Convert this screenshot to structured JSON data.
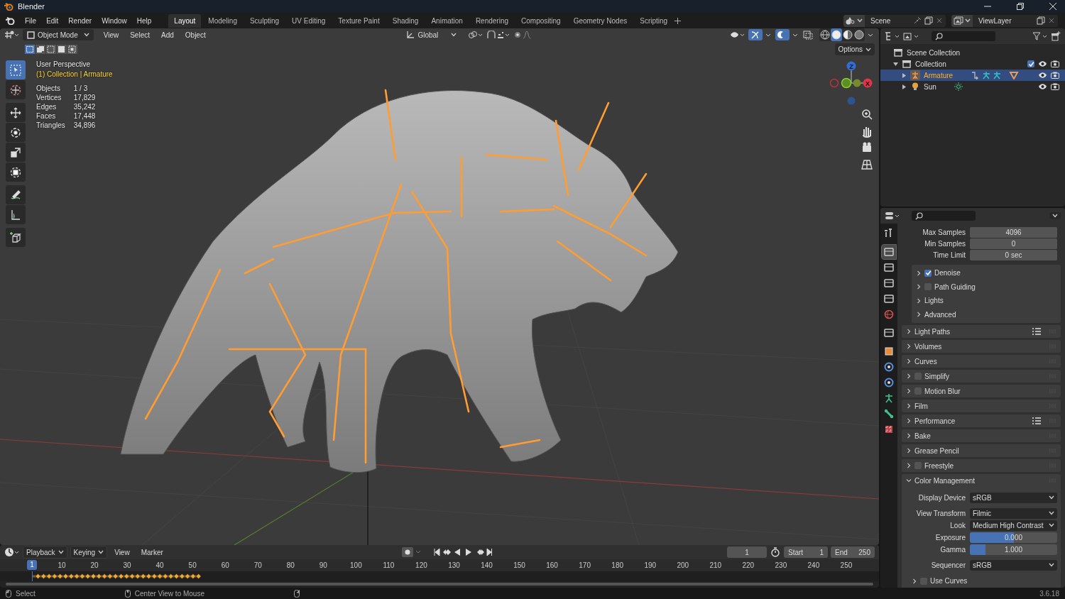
{
  "window": {
    "title": "Blender"
  },
  "menu": [
    "File",
    "Edit",
    "Render",
    "Window",
    "Help"
  ],
  "workspaces": [
    {
      "label": "Layout",
      "selected": true
    },
    {
      "label": "Modeling",
      "selected": false
    },
    {
      "label": "Sculpting",
      "selected": false
    },
    {
      "label": "UV Editing",
      "selected": false
    },
    {
      "label": "Texture Paint",
      "selected": false
    },
    {
      "label": "Shading",
      "selected": false
    },
    {
      "label": "Animation",
      "selected": false
    },
    {
      "label": "Rendering",
      "selected": false
    },
    {
      "label": "Compositing",
      "selected": false
    },
    {
      "label": "Geometry Nodes",
      "selected": false
    },
    {
      "label": "Scripting",
      "selected": false
    }
  ],
  "scene": "Scene",
  "view_layer": "ViewLayer",
  "viewport": {
    "mode": "Object Mode",
    "menus": [
      "View",
      "Select",
      "Add",
      "Object"
    ],
    "orientation": "Global",
    "options": "Options",
    "view_name": "User Perspective",
    "context": "(1) Collection | Armature",
    "stats": [
      {
        "label": "Objects",
        "value": "1 / 3"
      },
      {
        "label": "Vertices",
        "value": "17,829"
      },
      {
        "label": "Edges",
        "value": "35,242"
      },
      {
        "label": "Faces",
        "value": "17,448"
      },
      {
        "label": "Triangles",
        "value": "34,896"
      }
    ],
    "shading": [
      {
        "kind": "wireframe",
        "selected": false
      },
      {
        "kind": "solid",
        "selected": true
      },
      {
        "kind": "material",
        "selected": false
      },
      {
        "kind": "rendered",
        "selected": false
      }
    ],
    "axes": [
      {
        "label": "Z",
        "color": "#2f6fd5"
      },
      {
        "label": "X",
        "color": "#e0344a"
      }
    ]
  },
  "tools": [
    {
      "kind": "select",
      "selected": true
    },
    {
      "kind": "cursor",
      "selected": false
    },
    {
      "kind": "move",
      "selected": false
    },
    {
      "kind": "rotate",
      "selected": false
    },
    {
      "kind": "scale",
      "selected": false
    },
    {
      "kind": "transform",
      "selected": false
    },
    {
      "kind": "annotate",
      "selected": false
    },
    {
      "kind": "measure",
      "selected": false
    },
    {
      "kind": "add-cube",
      "selected": false
    }
  ],
  "outliner": [
    {
      "label": "Scene Collection",
      "kind": "scene",
      "selected": false,
      "children": [
        {
          "label": "Collection",
          "kind": "collection",
          "selected": false,
          "expanded": true,
          "checked": true,
          "children": [
            {
              "label": "Armature",
              "kind": "armature",
              "selected": true,
              "expanded": false
            },
            {
              "label": "Sun",
              "kind": "light",
              "selected": false,
              "expanded": false
            }
          ]
        }
      ]
    }
  ],
  "properties": {
    "tabs": [
      {
        "kind": "tool",
        "selected": false
      },
      {
        "kind": "render",
        "selected": true
      },
      {
        "kind": "output",
        "selected": false
      },
      {
        "kind": "view-layer",
        "selected": false
      },
      {
        "kind": "scene",
        "selected": false
      },
      {
        "kind": "world",
        "selected": false
      },
      {
        "kind": "collection",
        "selected": false
      },
      {
        "kind": "object",
        "selected": false
      },
      {
        "kind": "physics",
        "selected": false
      },
      {
        "kind": "constraints",
        "selected": false
      },
      {
        "kind": "data",
        "selected": false
      },
      {
        "kind": "bone",
        "selected": false
      },
      {
        "kind": "texture",
        "selected": false
      }
    ],
    "fields": [
      {
        "label": "Max Samples",
        "value": "4096"
      },
      {
        "label": "Min Samples",
        "value": "0"
      },
      {
        "label": "Time Limit",
        "value": "0 sec"
      }
    ],
    "subpanels": [
      {
        "label": "Denoise",
        "kind": "checkbox",
        "checked": true,
        "expanded": false
      },
      {
        "label": "Path Guiding",
        "kind": "checkbox",
        "checked": false,
        "expanded": false
      },
      {
        "label": "Lights",
        "kind": "plain",
        "expanded": false
      },
      {
        "label": "Advanced",
        "kind": "plain",
        "expanded": false
      }
    ],
    "panels": [
      {
        "label": "Light Paths",
        "kind": "presets",
        "expanded": false
      },
      {
        "label": "Volumes",
        "kind": "plain",
        "expanded": false
      },
      {
        "label": "Curves",
        "kind": "plain",
        "expanded": false
      },
      {
        "label": "Simplify",
        "kind": "checkbox",
        "checked": false,
        "expanded": false
      },
      {
        "label": "Motion Blur",
        "kind": "checkbox",
        "checked": false,
        "expanded": false
      },
      {
        "label": "Film",
        "kind": "plain",
        "expanded": false
      },
      {
        "label": "Performance",
        "kind": "presets",
        "expanded": false
      },
      {
        "label": "Bake",
        "kind": "plain",
        "expanded": false
      },
      {
        "label": "Grease Pencil",
        "kind": "plain",
        "expanded": false
      },
      {
        "label": "Freestyle",
        "kind": "checkbox",
        "checked": false,
        "expanded": false
      },
      {
        "label": "Color Management",
        "kind": "plain",
        "expanded": true
      }
    ],
    "color_management": [
      {
        "label": "Display Device",
        "kind": "dropdown",
        "value": "sRGB"
      },
      {
        "label": "View Transform",
        "kind": "dropdown",
        "value": "Filmic"
      },
      {
        "label": "Look",
        "kind": "dropdown",
        "value": "Medium High Contrast"
      },
      {
        "label": "Exposure",
        "kind": "slider",
        "value": "0.000",
        "level": 0.5
      },
      {
        "label": "Gamma",
        "kind": "slider",
        "value": "1.000",
        "level": 0.18
      },
      {
        "label": "Sequencer",
        "kind": "dropdown",
        "value": "sRGB"
      }
    ],
    "use_curves": {
      "label": "Use Curves",
      "checked": false,
      "expanded": false
    }
  },
  "timeline": {
    "menus": [
      {
        "label": "Playback",
        "kind": "dropdown"
      },
      {
        "label": "Keying",
        "kind": "dropdown"
      },
      {
        "label": "View",
        "kind": "menu"
      },
      {
        "label": "Marker",
        "kind": "menu"
      }
    ],
    "current_frame": "1",
    "start_label": "Start",
    "start": "1",
    "end_label": "End",
    "end": "250",
    "playhead": "1",
    "ruler": [
      "10",
      "20",
      "30",
      "40",
      "50",
      "60",
      "70",
      "80",
      "90",
      "100",
      "110",
      "120",
      "130",
      "140",
      "150",
      "160",
      "170",
      "180",
      "190",
      "200",
      "210",
      "220",
      "230",
      "240",
      "250"
    ]
  },
  "status_bar": {
    "hints": [
      "Select",
      "Center View to Mouse"
    ],
    "version": "3.6.18"
  }
}
